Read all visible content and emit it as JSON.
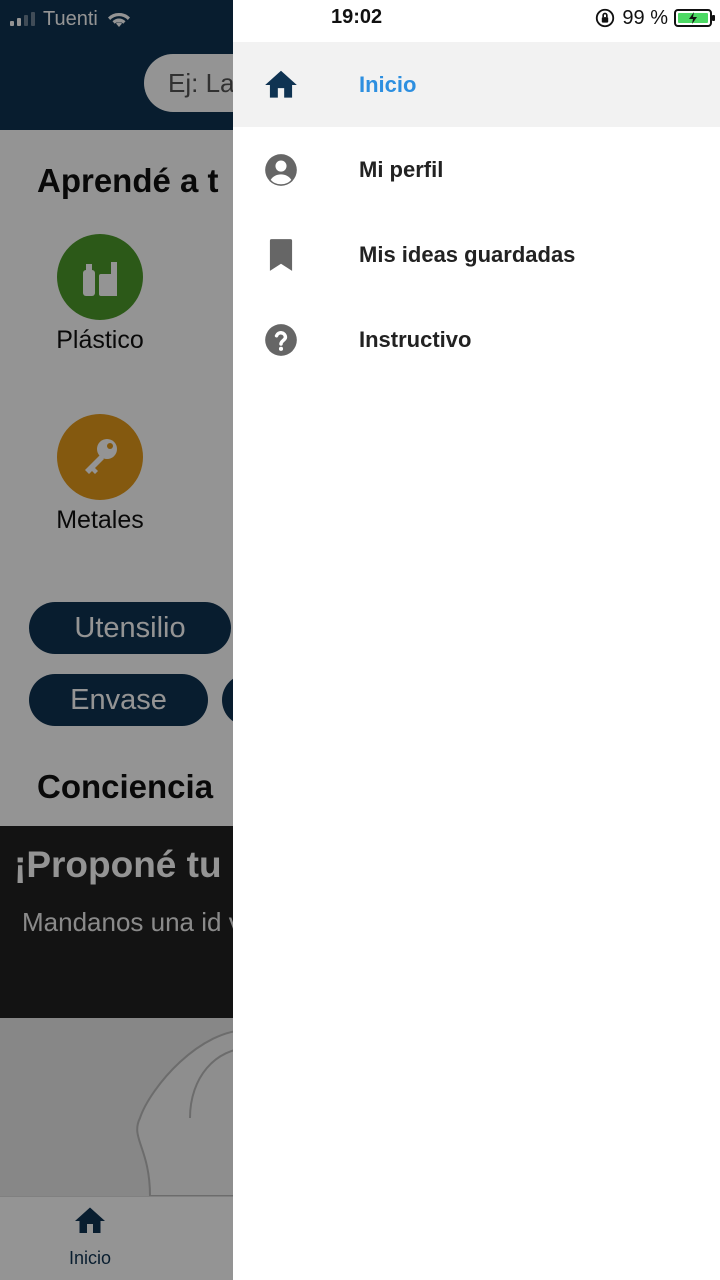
{
  "status_bar": {
    "carrier": "Tuenti",
    "time": "19:02",
    "battery": "99 %"
  },
  "app": {
    "search_placeholder": "Ej: La",
    "learn_title": "Aprendé a t",
    "categories": [
      {
        "label": "Plástico",
        "color": "#4c9a2a",
        "icon": "plastic-bottles-icon"
      },
      {
        "label": "Metales",
        "color": "#e49a1a",
        "icon": "key-icon"
      }
    ],
    "chips": [
      "Utensilio",
      "Envase"
    ],
    "awareness_title": "Conciencia",
    "promo": {
      "title": "¡Proponé tu",
      "text": "Mandanos una id vida a un product premios."
    },
    "tabbar": {
      "home_label": "Inicio"
    }
  },
  "drawer": {
    "items": [
      {
        "label": "Inicio",
        "icon": "home-icon",
        "active": true
      },
      {
        "label": "Mi perfil",
        "icon": "account-icon",
        "active": false
      },
      {
        "label": "Mis ideas guardadas",
        "icon": "bookmark-icon",
        "active": false
      },
      {
        "label": "Instructivo",
        "icon": "help-icon",
        "active": false
      }
    ]
  },
  "colors": {
    "primary": "#0f3352",
    "accent": "#2d8fe0",
    "active_bg": "#f2f2f2"
  }
}
